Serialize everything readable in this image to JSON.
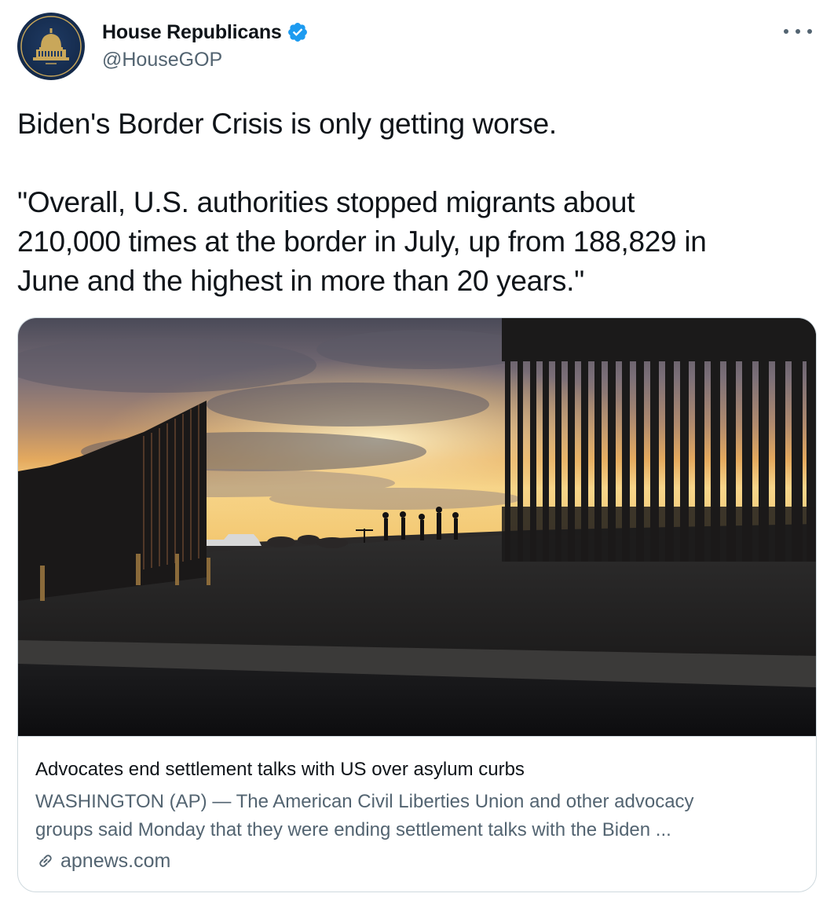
{
  "tweet": {
    "author": {
      "display_name": "House Republicans",
      "handle": "@HouseGOP",
      "verified": true,
      "avatar_icon": "capitol-dome-seal",
      "verified_icon": "verified-badge-icon"
    },
    "more_icon": "more-options-icon",
    "text_lines": {
      "line1": "Biden's Border Crisis is only getting worse.",
      "line2": "\"Overall, U.S. authorities stopped migrants about",
      "line3": "210,000 times at the border in July, up from 188,829 in",
      "line4": "June and the highest in more than 20 years.\""
    },
    "card": {
      "image_icon": "border-wall-sunset-photo",
      "title": "Advocates end settlement talks with US over asylum curbs",
      "description_line1": "WASHINGTON (AP) — The American Civil Liberties Union and other advocacy",
      "description_line2": "groups said Monday that they were ending settlement talks with the Biden ...",
      "domain": "apnews.com",
      "link_icon": "link-icon"
    }
  },
  "colors": {
    "text_primary": "#0f1419",
    "text_secondary": "#536471",
    "verified_blue": "#1d9bf0",
    "border": "#cfd9de",
    "avatar_navy": "#1f3a63"
  }
}
